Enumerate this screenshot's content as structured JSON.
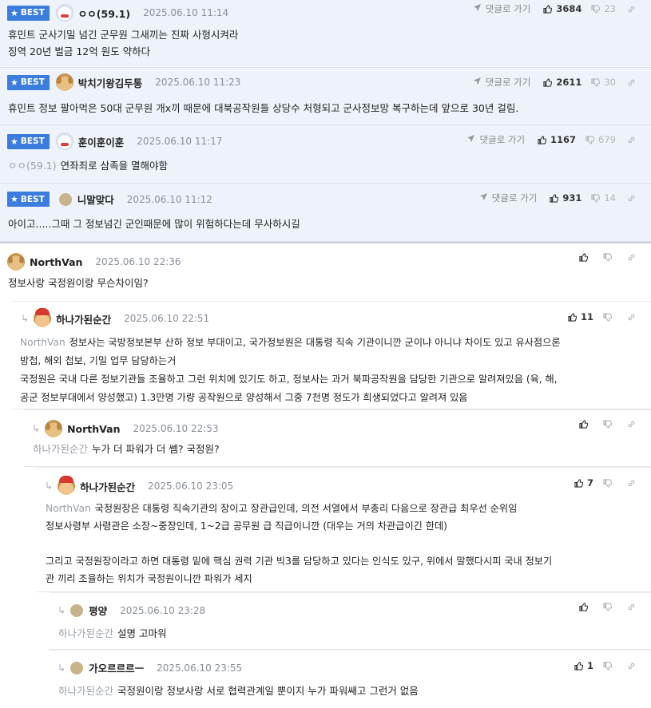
{
  "best_label": "BEST",
  "goto_label": "댓글로 가기",
  "best_comments": [
    {
      "nick": "ㅇㅇ(59.1)",
      "date": "2025.06.10 11:14",
      "up": "3684",
      "down": "23",
      "lines": [
        "휴민트 군사기밀 넘긴 군무원 그새끼는 진짜 사형시켜라",
        "징역 20년 벌금 12억 원도 약하다"
      ]
    },
    {
      "nick": "박치기왕김두통",
      "date": "2025.06.10 11:23",
      "up": "2611",
      "down": "30",
      "lines": [
        "휴민트 정보 팔아먹은 50대 군무원 개x끼 때문에 대북공작원들 상당수 처형되고 군사정보망 복구하는데 앞으로 30년 걸림."
      ]
    },
    {
      "nick": "훈이훈이훈",
      "date": "2025.06.10 11:17",
      "up": "1167",
      "down": "679",
      "reply_to": "ㅇㅇ(59.1)",
      "lines": [
        "연좌죄로 삼족을 멸해야함"
      ]
    },
    {
      "nick": "니말맞다",
      "date": "2025.06.10 11:12",
      "up": "931",
      "down": "14",
      "lines": [
        "아이고.....그때 그 정보넘긴 군인때문에 많이 위험하다는데 무사하시길"
      ]
    }
  ],
  "comments": [
    {
      "nick": "NorthVan",
      "date": "2025.06.10 22:36",
      "up": "",
      "lines": [
        "정보사랑 국정원이랑 무슨차이임?"
      ]
    },
    {
      "nick": "하나가된순간",
      "date": "2025.06.10 22:51",
      "up": "11",
      "reply_to": "NorthVan",
      "lines": [
        "정보사는 국방정보본부 산하 정보 부대이고, 국가정보원은 대통령 직속 기관이니깐 군이냐 아니냐 차이도 있고 유사점으론",
        "방첩, 해외 첩보, 기밀 업무 담당하는거",
        "국정원은 국내 다른 정보기관들 조율하고 그런 위치에 있기도 하고, 정보사는 과거 북파공작원을 담당한 기관으로 알려져있음 (육, 해,",
        "공군 정보부대에서 양성했고) 1.3만명 가량 공작원으로 양성해서 그중 7천명 정도가 희생되었다고 알려져 있음"
      ]
    },
    {
      "nick": "NorthVan",
      "date": "2025.06.10 22:53",
      "up": "",
      "reply_to": "하나가된순간",
      "lines": [
        "누가 더 파워가 더 쎔? 국정원?"
      ]
    },
    {
      "nick": "하나가된순간",
      "date": "2025.06.10 23:05",
      "up": "7",
      "reply_to": "NorthVan",
      "lines": [
        "국정원장은 대통령 직속기관의 장이고 장관급인데, 의전 서열에서 부총리 다음으로 장관급 최우선 순위임",
        "정보사령부 사령관은 소장~중장인데, 1~2급 공무원 급 직급이니깐 (대우는 거의 차관급이긴 한데)",
        "",
        "그리고 국정원장이라고 하면 대통령 밑에 핵심 권력 기관 빅3를 담당하고 있다는 인식도 있구, 위에서 말했다시피 국내 정보기",
        "관 끼리 조율하는 위치가 국정원이니깐 파워가 세지"
      ]
    },
    {
      "nick": "평양",
      "date": "2025.06.10 23:28",
      "up": "",
      "reply_to": "하나가된순간",
      "lines": [
        "설명 고마워"
      ]
    },
    {
      "nick": "가오르르르ㅡ",
      "date": "2025.06.10 23:55",
      "up": "1",
      "reply_to": "하나가된순간",
      "lines": [
        "국정원이랑 정보사랑 서로 협력관계일 뿐이지 누가 파워쌔고 그런거 없음"
      ]
    }
  ]
}
